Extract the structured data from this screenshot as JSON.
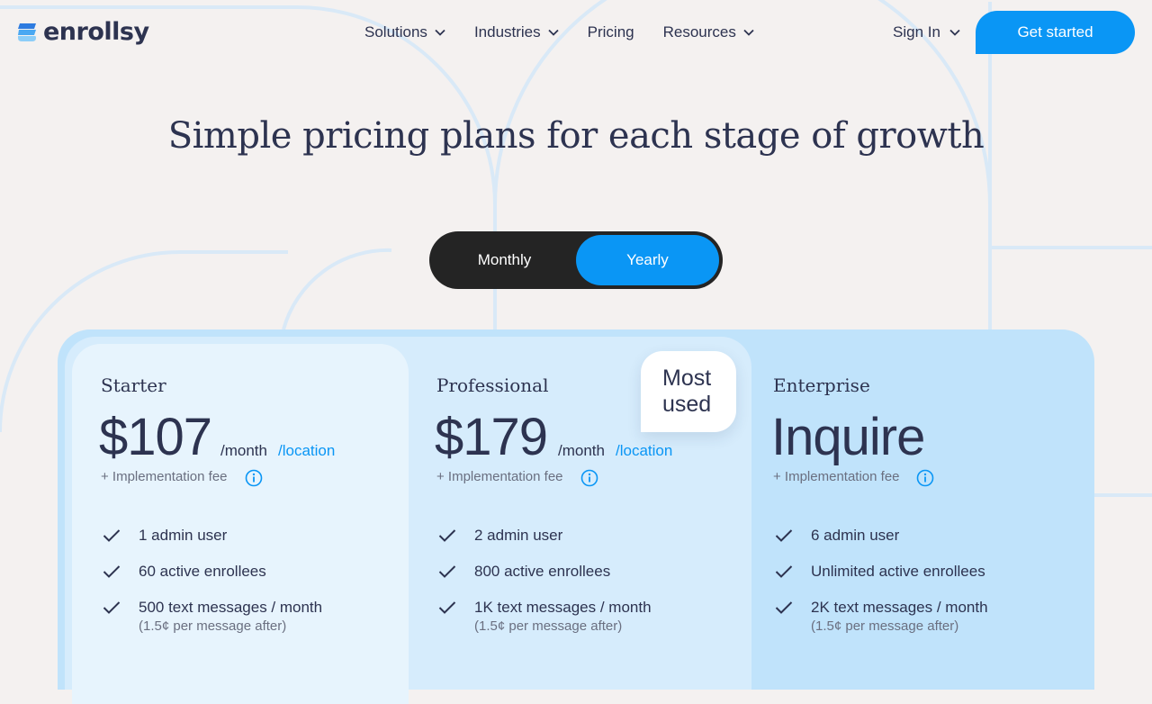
{
  "brand": {
    "name": "enrollsy"
  },
  "nav": {
    "items": [
      {
        "label": "Solutions",
        "dropdown": true
      },
      {
        "label": "Industries",
        "dropdown": true
      },
      {
        "label": "Pricing",
        "dropdown": false
      },
      {
        "label": "Resources",
        "dropdown": true
      }
    ],
    "sign_in": "Sign In",
    "cta": "Get started"
  },
  "hero": {
    "headline": "Simple pricing plans for each stage of growth"
  },
  "billing_toggle": {
    "options": [
      "Monthly",
      "Yearly"
    ],
    "selected": "Yearly"
  },
  "plans": [
    {
      "name": "Starter",
      "price": "$107",
      "per": "/month",
      "unit": "/location",
      "fee": "+ Implementation fee",
      "features": [
        {
          "text": "1 admin user"
        },
        {
          "text": "60 active enrollees"
        },
        {
          "text": "500 text messages / month",
          "sub": "(1.5¢ per message after)"
        }
      ]
    },
    {
      "name": "Professional",
      "price": "$179",
      "per": "/month",
      "unit": "/location",
      "fee": "+ Implementation fee",
      "badge": "Most used",
      "features": [
        {
          "text": "2 admin user"
        },
        {
          "text": "800 active enrollees"
        },
        {
          "text": "1K text messages / month",
          "sub": "(1.5¢ per message after)"
        }
      ]
    },
    {
      "name": "Enterprise",
      "price": "Inquire",
      "fee": "+ Implementation fee",
      "features": [
        {
          "text": "6 admin user"
        },
        {
          "text": "Unlimited active enrollees"
        },
        {
          "text": "2K text messages / month",
          "sub": "(1.5¢ per message after)"
        }
      ]
    }
  ],
  "colors": {
    "accent": "#0a96f5",
    "text": "#2d3350",
    "background": "#f4f1f0",
    "toggle_bg": "#242424"
  },
  "icons": [
    "chevron-down-icon",
    "info-icon",
    "check-icon",
    "logo-mark"
  ]
}
